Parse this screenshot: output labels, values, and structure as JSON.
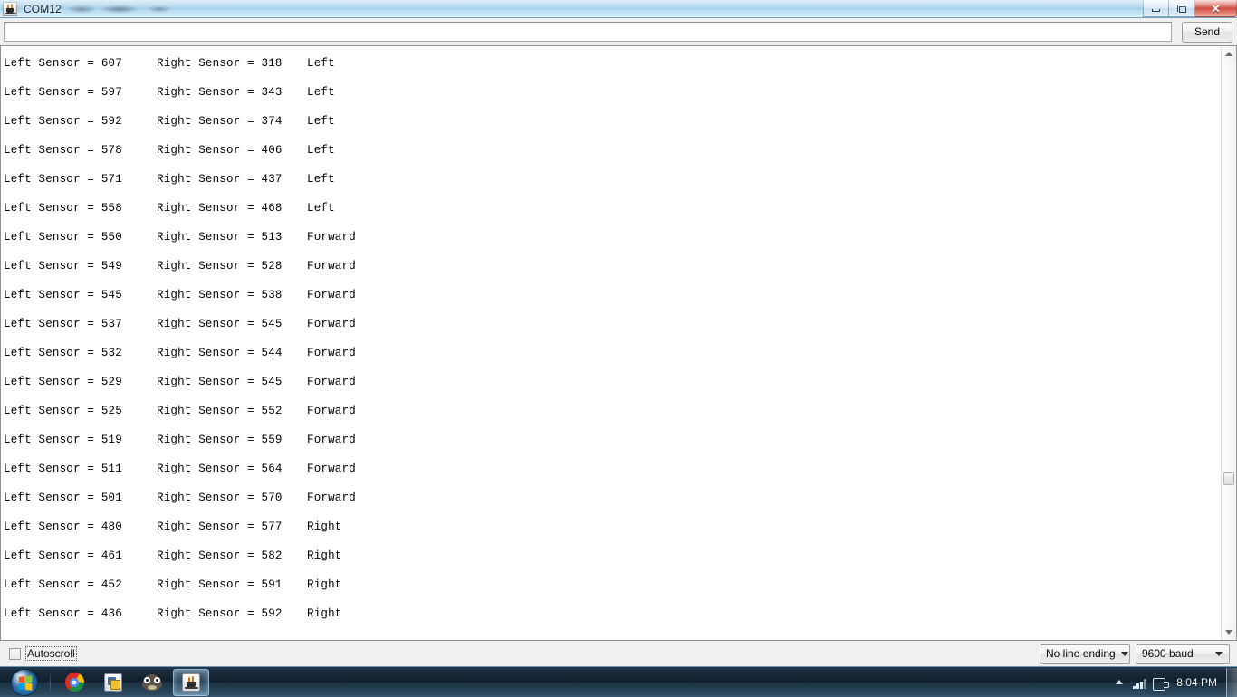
{
  "window": {
    "title": "COM12",
    "title_redacted": true,
    "app_icon": "java-coffee-cup-icon",
    "controls": {
      "minimize": "minimize-icon",
      "restore": "restore-icon",
      "close": "✕"
    }
  },
  "toolbar": {
    "input_value": "",
    "input_placeholder": "",
    "send_label": "Send"
  },
  "serial_output": {
    "columns": [
      "left_sensor",
      "right_sensor",
      "direction"
    ],
    "lines": [
      {
        "left": "Left Sensor = 607",
        "right": "Right Sensor = 318",
        "dir": "Left"
      },
      {
        "left": "Left Sensor = 597",
        "right": "Right Sensor = 343",
        "dir": "Left"
      },
      {
        "left": "Left Sensor = 592",
        "right": "Right Sensor = 374",
        "dir": "Left"
      },
      {
        "left": "Left Sensor = 578",
        "right": "Right Sensor = 406",
        "dir": "Left"
      },
      {
        "left": "Left Sensor = 571",
        "right": "Right Sensor = 437",
        "dir": "Left"
      },
      {
        "left": "Left Sensor = 558",
        "right": "Right Sensor = 468",
        "dir": "Left"
      },
      {
        "left": "Left Sensor = 550",
        "right": "Right Sensor = 513",
        "dir": "Forward"
      },
      {
        "left": "Left Sensor = 549",
        "right": "Right Sensor = 528",
        "dir": "Forward"
      },
      {
        "left": "Left Sensor = 545",
        "right": "Right Sensor = 538",
        "dir": "Forward"
      },
      {
        "left": "Left Sensor = 537",
        "right": "Right Sensor = 545",
        "dir": "Forward"
      },
      {
        "left": "Left Sensor = 532",
        "right": "Right Sensor = 544",
        "dir": "Forward"
      },
      {
        "left": "Left Sensor = 529",
        "right": "Right Sensor = 545",
        "dir": "Forward"
      },
      {
        "left": "Left Sensor = 525",
        "right": "Right Sensor = 552",
        "dir": "Forward"
      },
      {
        "left": "Left Sensor = 519",
        "right": "Right Sensor = 559",
        "dir": "Forward"
      },
      {
        "left": "Left Sensor = 511",
        "right": "Right Sensor = 564",
        "dir": "Forward"
      },
      {
        "left": "Left Sensor = 501",
        "right": "Right Sensor = 570",
        "dir": "Forward"
      },
      {
        "left": "Left Sensor = 480",
        "right": "Right Sensor = 577",
        "dir": "Right"
      },
      {
        "left": "Left Sensor = 461",
        "right": "Right Sensor = 582",
        "dir": "Right"
      },
      {
        "left": "Left Sensor = 452",
        "right": "Right Sensor = 591",
        "dir": "Right"
      },
      {
        "left": "Left Sensor = 436",
        "right": "Right Sensor = 592",
        "dir": "Right"
      }
    ]
  },
  "scrollbar": {
    "up_arrow": "scroll-up-icon",
    "down_arrow": "scroll-down-icon",
    "thumb_position_percent": 72
  },
  "status_bar": {
    "autoscroll_label": "Autoscroll",
    "autoscroll_checked": false,
    "line_ending_value": "No line ending",
    "baud_value": "9600 baud"
  },
  "taskbar": {
    "start_label": "start-orb",
    "items": [
      {
        "name": "chrome",
        "icon": "chrome-icon"
      },
      {
        "name": "app",
        "icon": "app-icon"
      },
      {
        "name": "gimp",
        "icon": "gimp-icon"
      },
      {
        "name": "serial-monitor",
        "icon": "java-icon",
        "active": true
      }
    ],
    "tray": {
      "expand": "show-hidden-icons-icon",
      "network": "network-signal-icon",
      "power": "power-plug-icon",
      "clock": "8:04 PM"
    }
  }
}
